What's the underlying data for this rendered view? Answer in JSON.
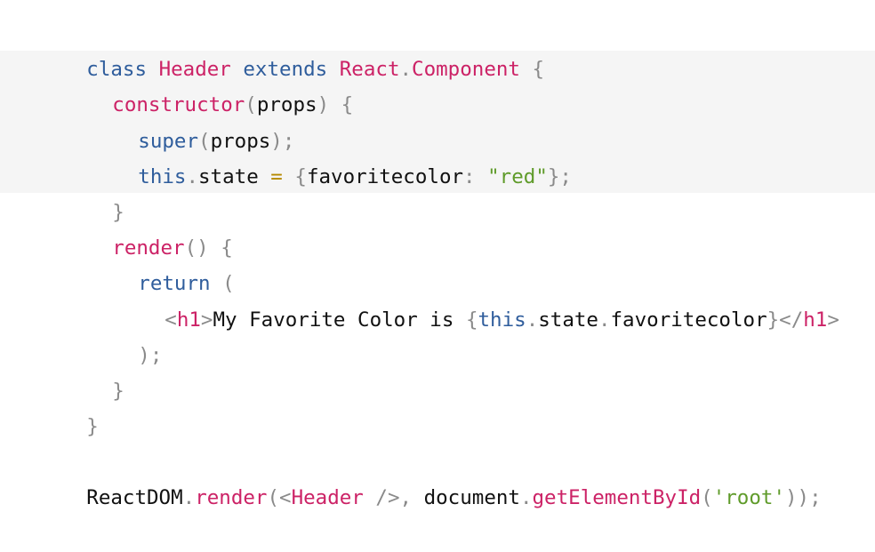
{
  "editor": {
    "lines": [
      {
        "id": "line-1",
        "tokens": [
          {
            "text": "class ",
            "kind": "kw-blue"
          },
          {
            "text": "Header ",
            "kind": "kw-red"
          },
          {
            "text": "extends ",
            "kind": "kw-blue"
          },
          {
            "text": "React",
            "kind": "kw-red"
          },
          {
            "text": ".",
            "kind": "punc"
          },
          {
            "text": "Component ",
            "kind": "kw-red"
          },
          {
            "text": "{",
            "kind": "punc"
          }
        ]
      },
      {
        "id": "line-2",
        "tokens": [
          {
            "text": "constructor",
            "kind": "kw-red"
          },
          {
            "text": "(",
            "kind": "punc"
          },
          {
            "text": "props",
            "kind": "txt"
          },
          {
            "text": ") ",
            "kind": "punc"
          },
          {
            "text": "{",
            "kind": "punc"
          }
        ]
      },
      {
        "id": "line-3",
        "tokens": [
          {
            "text": "super",
            "kind": "kw-blue"
          },
          {
            "text": "(",
            "kind": "punc"
          },
          {
            "text": "props",
            "kind": "txt"
          },
          {
            "text": ");",
            "kind": "punc"
          }
        ]
      },
      {
        "id": "line-4",
        "tokens": [
          {
            "text": "this",
            "kind": "kw-blue"
          },
          {
            "text": ".",
            "kind": "punc"
          },
          {
            "text": "state ",
            "kind": "txt"
          },
          {
            "text": "= ",
            "kind": "op"
          },
          {
            "text": "{",
            "kind": "punc"
          },
          {
            "text": "favoritecolor",
            "kind": "txt"
          },
          {
            "text": ": ",
            "kind": "punc"
          },
          {
            "text": "\"red\"",
            "kind": "str"
          },
          {
            "text": "};",
            "kind": "punc"
          }
        ]
      },
      {
        "id": "line-5",
        "tokens": [
          {
            "text": "}",
            "kind": "punc"
          }
        ]
      },
      {
        "id": "line-6",
        "tokens": [
          {
            "text": "render",
            "kind": "kw-red"
          },
          {
            "text": "() ",
            "kind": "punc"
          },
          {
            "text": "{",
            "kind": "punc"
          }
        ]
      },
      {
        "id": "line-7",
        "tokens": [
          {
            "text": "return ",
            "kind": "kw-blue"
          },
          {
            "text": "(",
            "kind": "punc"
          }
        ]
      },
      {
        "id": "line-8",
        "tokens": [
          {
            "text": "<",
            "kind": "punc"
          },
          {
            "text": "h1",
            "kind": "kw-red"
          },
          {
            "text": ">",
            "kind": "punc"
          },
          {
            "text": "My Favorite Color is ",
            "kind": "txt"
          },
          {
            "text": "{",
            "kind": "punc"
          },
          {
            "text": "this",
            "kind": "kw-blue"
          },
          {
            "text": ".",
            "kind": "punc"
          },
          {
            "text": "state",
            "kind": "txt"
          },
          {
            "text": ".",
            "kind": "punc"
          },
          {
            "text": "favoritecolor",
            "kind": "txt"
          },
          {
            "text": "}",
            "kind": "punc"
          },
          {
            "text": "</",
            "kind": "punc"
          },
          {
            "text": "h1",
            "kind": "kw-red"
          },
          {
            "text": ">",
            "kind": "punc"
          }
        ]
      },
      {
        "id": "line-9",
        "tokens": [
          {
            "text": ");",
            "kind": "punc"
          }
        ]
      },
      {
        "id": "line-10",
        "tokens": [
          {
            "text": "}",
            "kind": "punc"
          }
        ]
      },
      {
        "id": "line-11",
        "tokens": [
          {
            "text": "}",
            "kind": "punc"
          }
        ]
      },
      {
        "id": "line-12",
        "tokens": []
      },
      {
        "id": "line-13",
        "tokens": [
          {
            "text": "ReactDOM",
            "kind": "txt"
          },
          {
            "text": ".",
            "kind": "punc"
          },
          {
            "text": "render",
            "kind": "kw-red"
          },
          {
            "text": "(",
            "kind": "punc"
          },
          {
            "text": "<",
            "kind": "punc"
          },
          {
            "text": "Header ",
            "kind": "kw-red"
          },
          {
            "text": "/>",
            "kind": "punc"
          },
          {
            "text": ", ",
            "kind": "punc"
          },
          {
            "text": "document",
            "kind": "txt"
          },
          {
            "text": ".",
            "kind": "punc"
          },
          {
            "text": "getElementById",
            "kind": "kw-red"
          },
          {
            "text": "(",
            "kind": "punc"
          },
          {
            "text": "'root'",
            "kind": "str"
          },
          {
            "text": "));",
            "kind": "punc"
          }
        ]
      }
    ]
  }
}
